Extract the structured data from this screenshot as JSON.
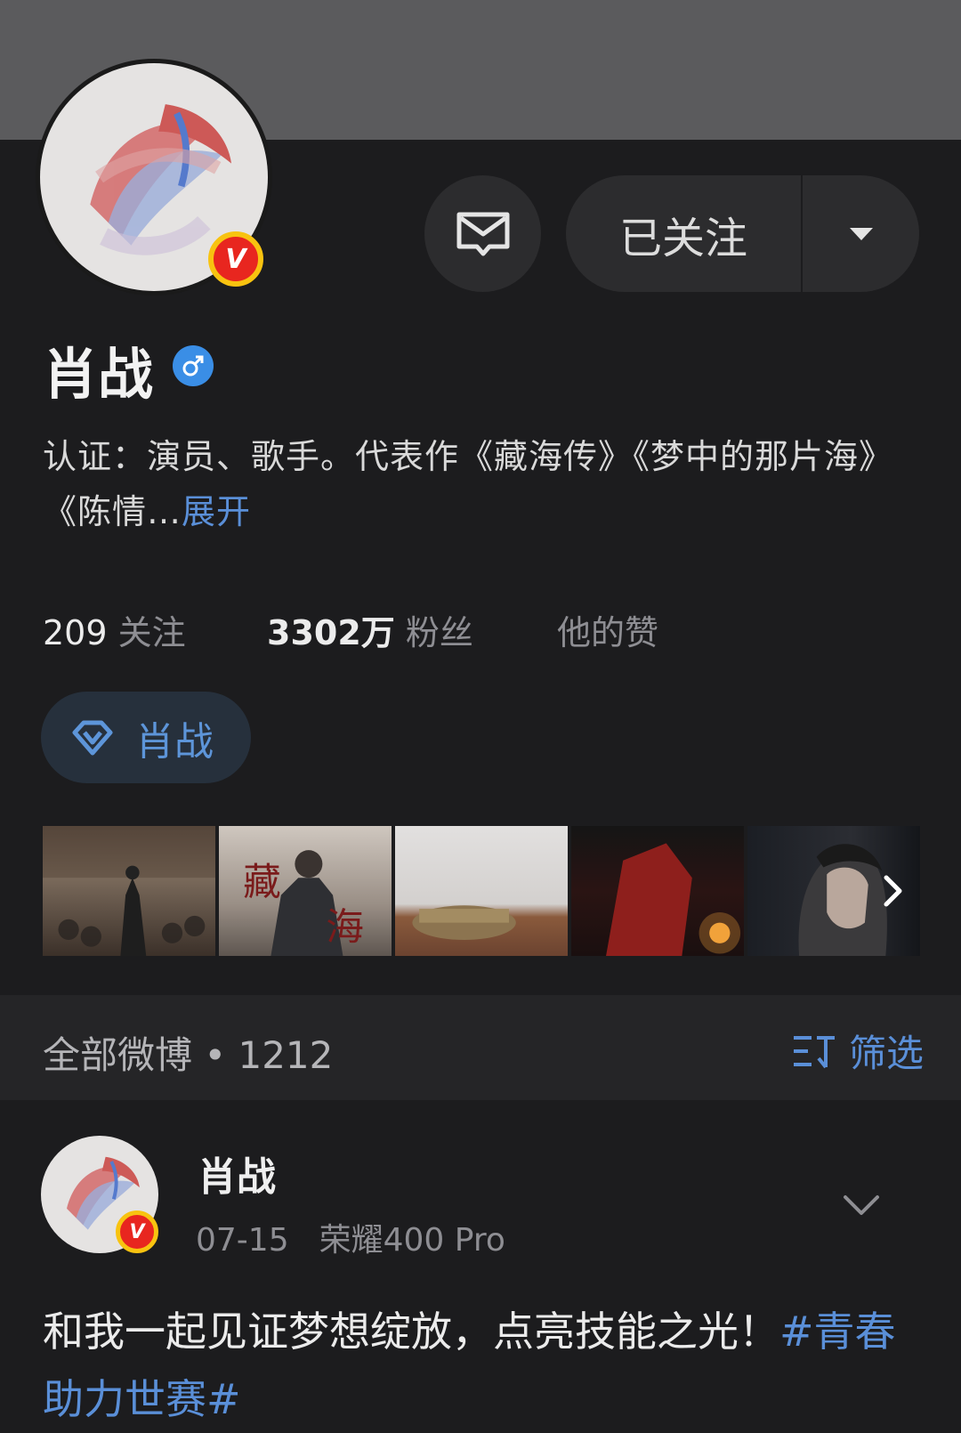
{
  "profile": {
    "name": "肖战",
    "follow_label": "已关注",
    "bio_text": "认证：演员、歌手。代表作《藏海传》《梦中的那片海》《陈情…",
    "bio_expand": "展开",
    "stats": {
      "following_count": "209",
      "following_label": "关注",
      "fans_count": "3302万",
      "fans_label": "粉丝",
      "likes_label": "他的赞"
    },
    "fan_badge_label": "肖战",
    "badge_letter": "V"
  },
  "feed_header": {
    "title": "全部微博 • 1212",
    "filter_label": "筛选"
  },
  "post": {
    "author": "肖战",
    "date": "07-15",
    "device": "荣耀400 Pro",
    "text": "和我一起见证梦想绽放，点亮技能之光！",
    "hashtag": "#青春助力世赛#"
  },
  "icons": {
    "message": "envelope-icon",
    "dropdown": "caret-down-icon",
    "gender": "male-icon",
    "fan_badge": "diamond-icon",
    "photos_next": "chevron-right-icon",
    "filter": "filter-icon",
    "post_menu": "chevron-down-icon"
  },
  "colors": {
    "accent_blue": "#5a8fd8",
    "background": "#1c1c1e",
    "verified_red": "#e8261f",
    "verified_gold": "#f8c310"
  }
}
